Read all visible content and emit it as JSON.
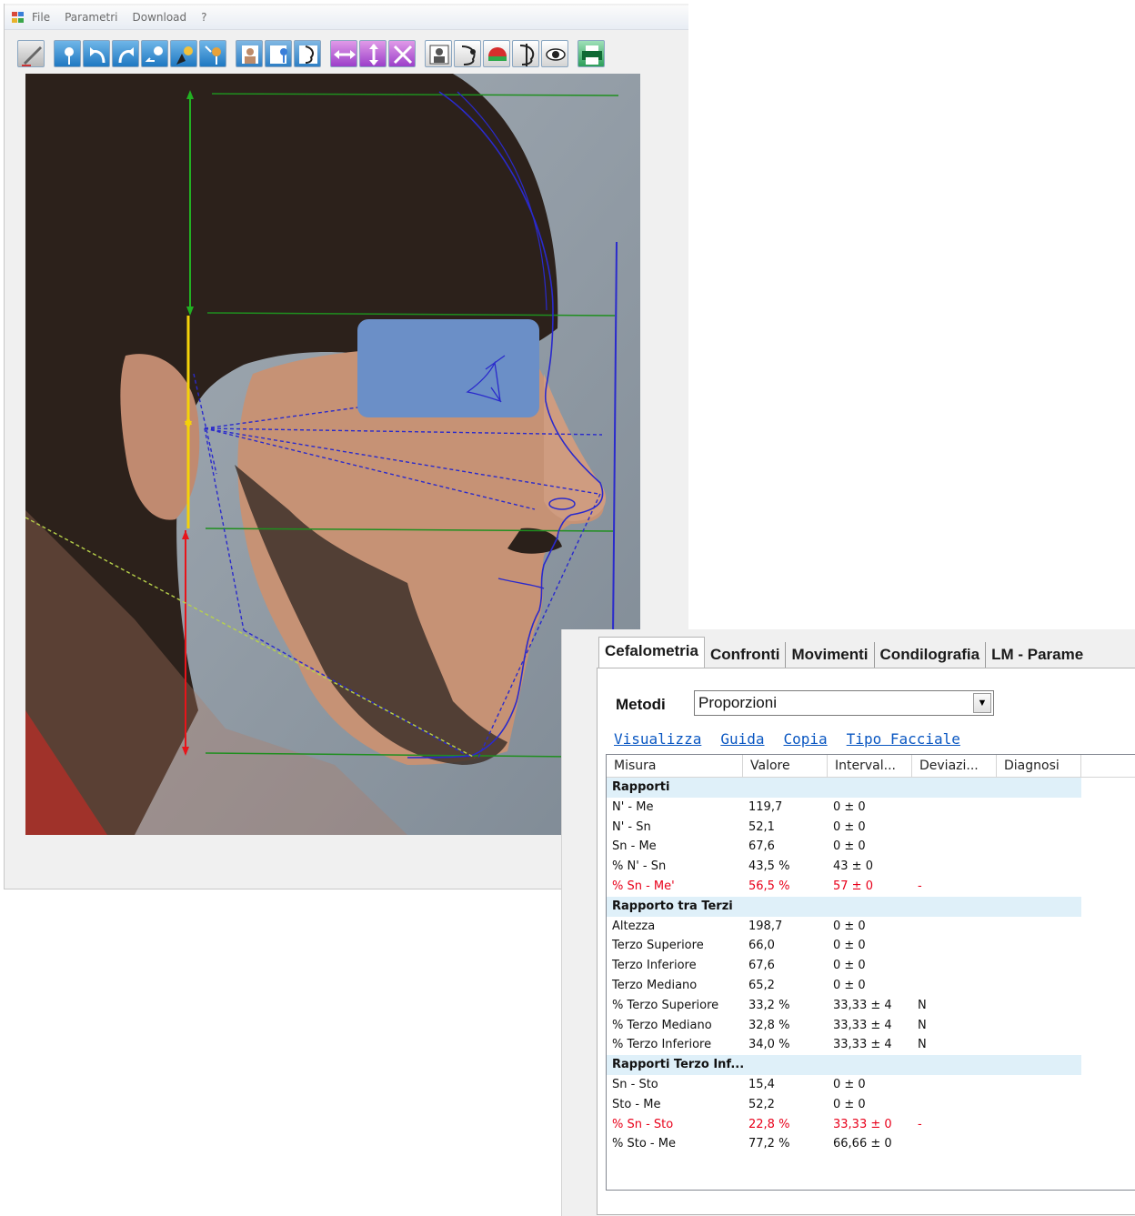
{
  "window": {
    "menu": [
      "File",
      "Parametri",
      "Download",
      "?"
    ]
  },
  "toolbar": {
    "buttons": [
      {
        "icon": "ruler-icon",
        "style": "c1"
      },
      {
        "icon": "map-pin-icon",
        "style": "c2"
      },
      {
        "icon": "undo-arrow-icon",
        "style": "c2"
      },
      {
        "icon": "redo-arrow-icon",
        "style": "c2"
      },
      {
        "icon": "pin-back-icon",
        "style": "c2"
      },
      {
        "icon": "pin-cursor-icon",
        "style": "c2"
      },
      {
        "icon": "pin-plus-icon",
        "style": "c2"
      },
      {
        "icon": "portrait-icon",
        "style": "c3"
      },
      {
        "icon": "portrait-pin-icon",
        "style": "c3"
      },
      {
        "icon": "profile-icon",
        "style": "c3"
      },
      {
        "icon": "move-horizontal-icon",
        "style": "c4"
      },
      {
        "icon": "move-vertical-icon",
        "style": "c4"
      },
      {
        "icon": "shrink-icon",
        "style": "c4"
      },
      {
        "icon": "photo-icon",
        "style": "c5"
      },
      {
        "icon": "head-point-icon",
        "style": "c5"
      },
      {
        "icon": "colour-hemisphere-icon",
        "style": "c5"
      },
      {
        "icon": "head-split-icon",
        "style": "c5"
      },
      {
        "icon": "eye-icon",
        "style": "c5"
      },
      {
        "icon": "printer-icon",
        "style": "c6"
      }
    ]
  },
  "overlay_colors": {
    "green": "#1f8f1f",
    "yellow": "#f5d20a",
    "red": "#e8141a",
    "blue": "#2a2acc",
    "eye_mask": "#6b8fc7"
  },
  "panel": {
    "tabs": [
      "Cefalometria",
      "Confronti",
      "Movimenti",
      "Condilografia",
      "LM - Parame"
    ],
    "active_tab": "Cefalometria",
    "metodi_label": "Metodi",
    "metodi_value": "Proporzioni",
    "links": [
      "Visualizza",
      "Guida",
      "Copia",
      "Tipo Facciale"
    ],
    "columns": [
      "Misura",
      "Valore",
      "Interval...",
      "Deviazi...",
      "Diagnosi"
    ],
    "rows": [
      {
        "type": "group",
        "label": "Rapporti"
      },
      {
        "misura": "N' - Me",
        "valore": "119,7",
        "intervallo": "0 ± 0",
        "deviazione": "",
        "diagnosi": ""
      },
      {
        "misura": "N' - Sn",
        "valore": "52,1",
        "intervallo": "0 ± 0",
        "deviazione": "",
        "diagnosi": ""
      },
      {
        "misura": "Sn - Me",
        "valore": "67,6",
        "intervallo": "0 ± 0",
        "deviazione": "",
        "diagnosi": ""
      },
      {
        "misura": "% N' - Sn",
        "valore": "43,5 %",
        "intervallo": "43 ± 0",
        "deviazione": "",
        "diagnosi": ""
      },
      {
        "misura": "% Sn - Me'",
        "valore": "56,5 %",
        "intervallo": "57 ± 0",
        "deviazione": "-",
        "diagnosi": "",
        "highlight": true
      },
      {
        "type": "group",
        "label": "Rapporto tra Terzi"
      },
      {
        "misura": "Altezza",
        "valore": "198,7",
        "intervallo": "0 ± 0",
        "deviazione": "",
        "diagnosi": ""
      },
      {
        "misura": "Terzo Superiore",
        "valore": "66,0",
        "intervallo": "0 ± 0",
        "deviazione": "",
        "diagnosi": ""
      },
      {
        "misura": "Terzo Inferiore",
        "valore": "67,6",
        "intervallo": "0 ± 0",
        "deviazione": "",
        "diagnosi": ""
      },
      {
        "misura": "Terzo Mediano",
        "valore": "65,2",
        "intervallo": "0 ± 0",
        "deviazione": "",
        "diagnosi": ""
      },
      {
        "misura": "% Terzo Superiore",
        "valore": "33,2 %",
        "intervallo": "33,33 ± 4",
        "deviazione": "N",
        "diagnosi": ""
      },
      {
        "misura": "% Terzo Mediano",
        "valore": "32,8 %",
        "intervallo": "33,33 ± 4",
        "deviazione": "N",
        "diagnosi": ""
      },
      {
        "misura": "% Terzo Inferiore",
        "valore": "34,0 %",
        "intervallo": "33,33 ± 4",
        "deviazione": "N",
        "diagnosi": ""
      },
      {
        "type": "group",
        "label": "Rapporti Terzo Inf..."
      },
      {
        "misura": "Sn - Sto",
        "valore": "15,4",
        "intervallo": "0 ± 0",
        "deviazione": "",
        "diagnosi": ""
      },
      {
        "misura": "Sto - Me",
        "valore": "52,2",
        "intervallo": "0 ± 0",
        "deviazione": "",
        "diagnosi": ""
      },
      {
        "misura": "% Sn - Sto",
        "valore": "22,8 %",
        "intervallo": "33,33 ± 0",
        "deviazione": "-",
        "diagnosi": "",
        "highlight": true
      },
      {
        "misura": "% Sto - Me",
        "valore": "77,2 %",
        "intervallo": "66,66 ± 0",
        "deviazione": "",
        "diagnosi": ""
      }
    ]
  }
}
